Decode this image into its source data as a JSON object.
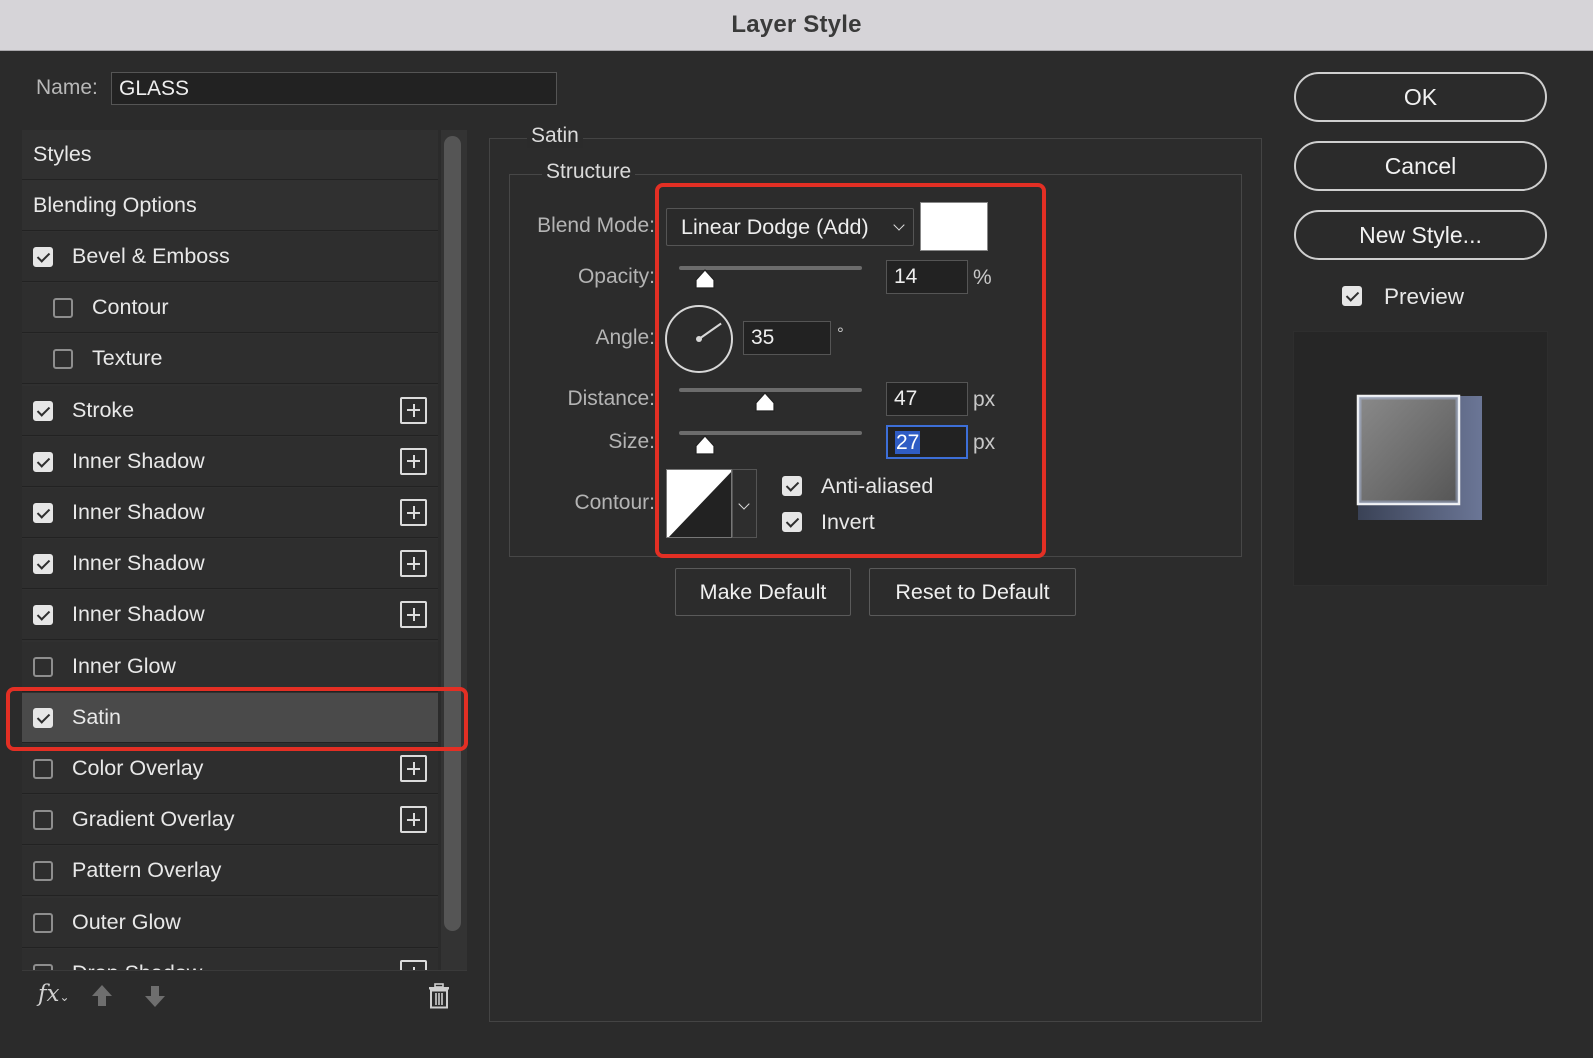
{
  "window": {
    "title": "Layer Style"
  },
  "name_field": {
    "label": "Name:",
    "value": "GLASS"
  },
  "styles_list": {
    "headers": [
      "Styles",
      "Blending Options"
    ],
    "items": [
      {
        "label": "Bevel & Emboss",
        "checked": true,
        "indent": false,
        "add": false
      },
      {
        "label": "Contour",
        "checked": false,
        "indent": true,
        "add": false
      },
      {
        "label": "Texture",
        "checked": false,
        "indent": true,
        "add": false
      },
      {
        "label": "Stroke",
        "checked": true,
        "indent": false,
        "add": true
      },
      {
        "label": "Inner Shadow",
        "checked": true,
        "indent": false,
        "add": true
      },
      {
        "label": "Inner Shadow",
        "checked": true,
        "indent": false,
        "add": true
      },
      {
        "label": "Inner Shadow",
        "checked": true,
        "indent": false,
        "add": true
      },
      {
        "label": "Inner Shadow",
        "checked": true,
        "indent": false,
        "add": true
      },
      {
        "label": "Inner Glow",
        "checked": false,
        "indent": false,
        "add": false
      },
      {
        "label": "Satin",
        "checked": true,
        "indent": false,
        "add": false,
        "selected": true
      },
      {
        "label": "Color Overlay",
        "checked": false,
        "indent": false,
        "add": true
      },
      {
        "label": "Gradient Overlay",
        "checked": false,
        "indent": false,
        "add": true
      },
      {
        "label": "Pattern Overlay",
        "checked": false,
        "indent": false,
        "add": false
      },
      {
        "label": "Outer Glow",
        "checked": false,
        "indent": false,
        "add": false
      },
      {
        "label": "Drop Shadow",
        "checked": false,
        "indent": false,
        "add": true
      }
    ],
    "footer": {
      "fx_label": "fx"
    }
  },
  "satin": {
    "section_title": "Satin",
    "group_title": "Structure",
    "blend_mode": {
      "label": "Blend Mode:",
      "value": "Linear Dodge (Add)",
      "color": "#ffffff"
    },
    "opacity": {
      "label": "Opacity:",
      "value": "14",
      "unit": "%",
      "fraction": 0.14
    },
    "angle": {
      "label": "Angle:",
      "value": "35",
      "unit": "°",
      "degrees": 35
    },
    "distance": {
      "label": "Distance:",
      "value": "47",
      "unit": "px",
      "fraction": 0.47
    },
    "size": {
      "label": "Size:",
      "value": "27",
      "unit": "px",
      "fraction": 0.14
    },
    "contour": {
      "label": "Contour:"
    },
    "anti_aliased": {
      "label": "Anti-aliased",
      "checked": true
    },
    "invert": {
      "label": "Invert",
      "checked": true
    },
    "make_default": "Make Default",
    "reset_default": "Reset to Default"
  },
  "actions": {
    "ok": "OK",
    "cancel": "Cancel",
    "new_style": "New Style...",
    "preview": {
      "label": "Preview",
      "checked": true
    }
  },
  "colors": {
    "highlight": "#e32f24",
    "focus": "#3d6fd8"
  }
}
